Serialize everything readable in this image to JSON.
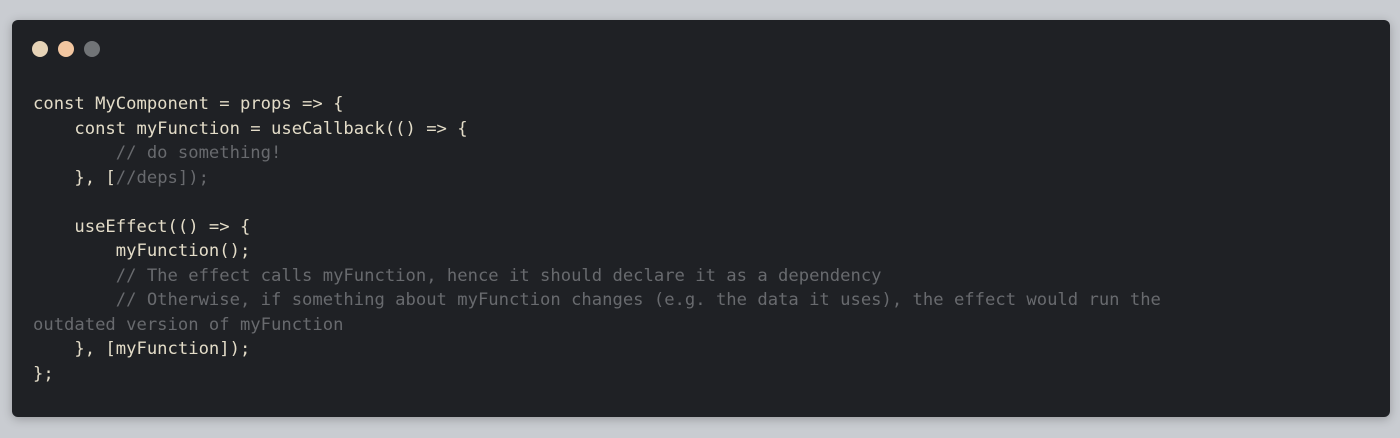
{
  "window": {
    "background": "#1f2125",
    "page_background": "#c9ccd1",
    "controls": [
      {
        "name": "close",
        "color": "#e6d3b7"
      },
      {
        "name": "minimize",
        "color": "#f2c6a0"
      },
      {
        "name": "zoom",
        "color": "#717477"
      }
    ]
  },
  "code": {
    "text_color": "#e3dcc8",
    "comment_color": "#686a6e",
    "lines": [
      [
        {
          "t": "const MyComponent = props => {",
          "c": "code"
        }
      ],
      [
        {
          "t": "    const myFunction = useCallback(() => {",
          "c": "code"
        }
      ],
      [
        {
          "t": "        // do something!",
          "c": "comment"
        }
      ],
      [
        {
          "t": "    }, [",
          "c": "code"
        },
        {
          "t": "//deps]);",
          "c": "comment"
        }
      ],
      [
        {
          "t": "",
          "c": "code"
        }
      ],
      [
        {
          "t": "    useEffect(() => {",
          "c": "code"
        }
      ],
      [
        {
          "t": "        myFunction();",
          "c": "code"
        }
      ],
      [
        {
          "t": "        // The effect calls myFunction, hence it should declare it as a dependency",
          "c": "comment"
        }
      ],
      [
        {
          "t": "        // Otherwise, if something about myFunction changes (e.g. the data it uses), the effect would run the",
          "c": "comment"
        }
      ],
      [
        {
          "t": "outdated version of myFunction",
          "c": "comment"
        }
      ],
      [
        {
          "t": "    }, [myFunction]);",
          "c": "code"
        }
      ],
      [
        {
          "t": "};",
          "c": "code"
        }
      ]
    ]
  }
}
